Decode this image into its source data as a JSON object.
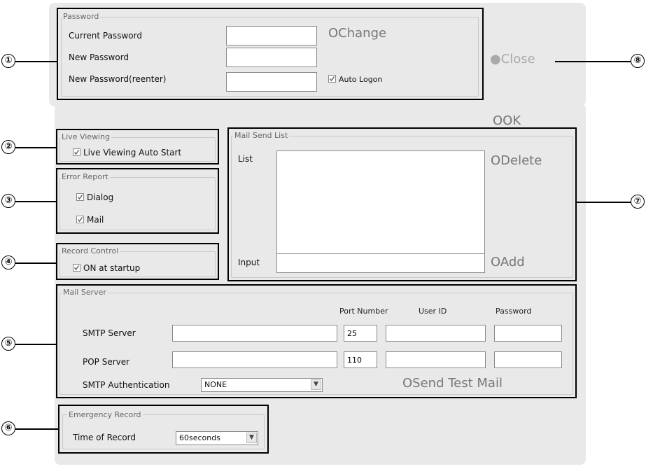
{
  "password": {
    "title": "Password",
    "current_label": "Current Password",
    "new_label": "New Password",
    "reenter_label": "New Password(reenter)",
    "change_btn": "OChange",
    "auto_logon_label": "Auto Logon",
    "auto_logon_checked": true
  },
  "close_btn": "●Close",
  "ok_btn": "OOK",
  "live_viewing": {
    "title": "Live Viewing",
    "auto_start_label": "Live Viewing Auto Start",
    "checked": true
  },
  "error_report": {
    "title": "Error Report",
    "dialog_label": "Dialog",
    "mail_label": "Mail",
    "dialog_checked": true,
    "mail_checked": true
  },
  "record_control": {
    "title": "Record Control",
    "on_startup_label": "ON at startup",
    "checked": true
  },
  "mail_send_list": {
    "title": "Mail Send List",
    "list_label": "List",
    "input_label": "Input",
    "delete_btn": "ODelete",
    "add_btn": "OAdd"
  },
  "mail_server": {
    "title": "Mail Server",
    "col_port": "Port Number",
    "col_user": "User ID",
    "col_password": "Password",
    "smtp_label": "SMTP Server",
    "smtp_port": "25",
    "pop_label": "POP Server",
    "pop_port": "110",
    "auth_label": "SMTP Authentication",
    "auth_value": "NONE",
    "send_test_btn": "OSend Test Mail"
  },
  "emergency_record": {
    "title": "Emergency Record",
    "time_label": "Time of Record",
    "time_value": "60seconds"
  },
  "callouts": [
    "①",
    "②",
    "③",
    "④",
    "⑤",
    "⑥",
    "⑦",
    "⑧"
  ]
}
